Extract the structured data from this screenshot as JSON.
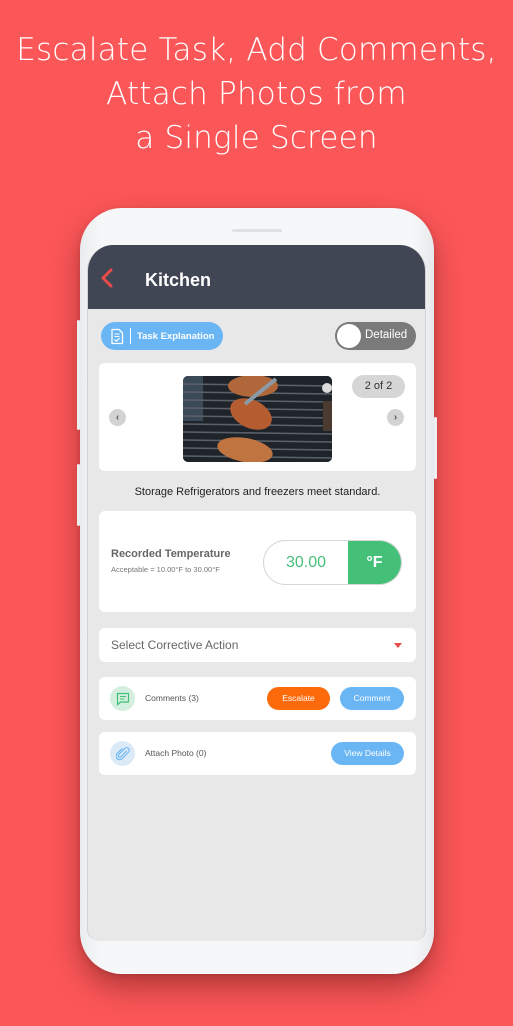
{
  "headline": {
    "line1": "Escalate Task, Add Comments,",
    "line2": "Attach Photos from",
    "line3": "a Single Screen"
  },
  "colors": {
    "background": "#fc5758",
    "appbar": "#414655",
    "accent_blue": "#6ab6f5",
    "accent_green": "#45c079",
    "accent_orange": "#fc6a0c",
    "back_arrow": "#e94a4a"
  },
  "appbar": {
    "back_icon": "chevron-left-icon",
    "title": "Kitchen"
  },
  "toolbar": {
    "task_explanation_label": "Task Explanation",
    "task_explanation_icon": "clipboard-check-icon",
    "detailed_toggle_label": "Detailed",
    "detailed_toggle_on": false
  },
  "carousel": {
    "counter": "2 of 2",
    "prev_icon": "chevron-left-icon",
    "next_icon": "chevron-right-icon",
    "current_index": 2,
    "total": 2
  },
  "task": {
    "description": "Storage Refrigerators and freezers meet standard."
  },
  "temperature": {
    "label": "Recorded Temperature",
    "acceptable": "Acceptable = 10.00°F to 30.00°F",
    "value": "30.00",
    "unit": "°F"
  },
  "corrective_action": {
    "placeholder": "Select Corrective Action",
    "icon": "caret-down-icon"
  },
  "comments": {
    "label": "Comments (3)",
    "icon": "comment-icon",
    "escalate_label": "Escalate",
    "comment_label": "Comment"
  },
  "attach_photo": {
    "label": "Attach Photo (0)",
    "icon": "paperclip-icon",
    "view_details_label": "View Details"
  }
}
